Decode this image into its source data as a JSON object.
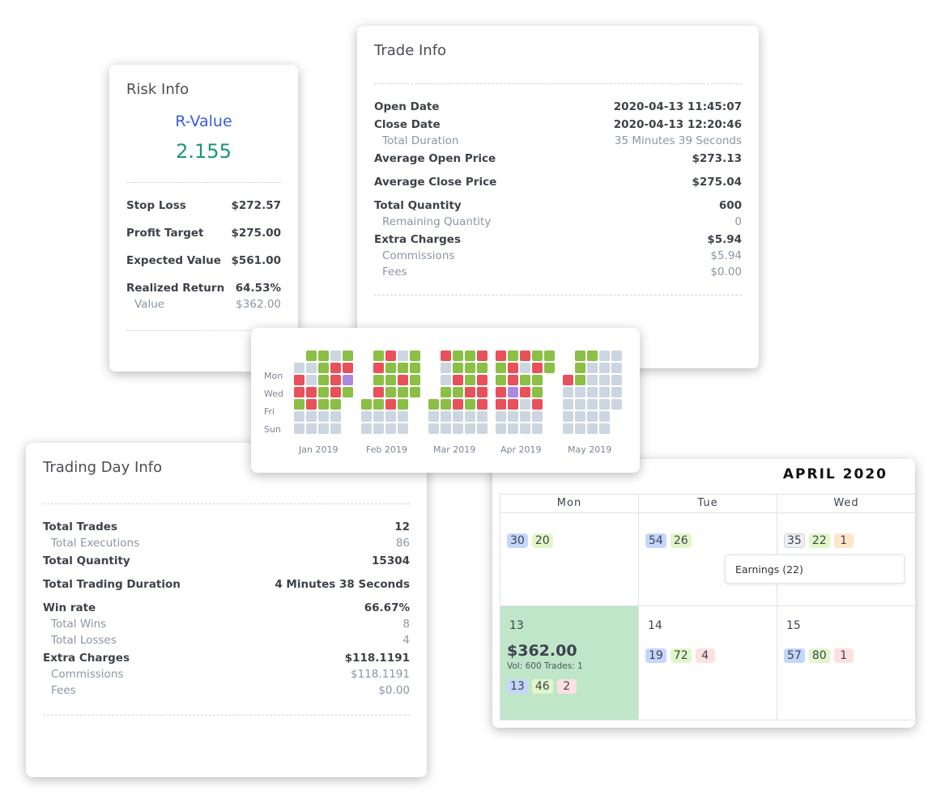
{
  "risk": {
    "title": "Risk Info",
    "rvalue_label": "R-Value",
    "rvalue": "2.155",
    "rows": [
      {
        "label": "Stop Loss",
        "value": "$272.57"
      },
      {
        "label": "Profit Target",
        "value": "$275.00"
      },
      {
        "label": "Expected Value",
        "value": "$561.00"
      },
      {
        "label": "Realized Return",
        "value": "64.53%"
      }
    ],
    "sub": {
      "label": "Value",
      "value": "$362.00"
    }
  },
  "trade": {
    "title": "Trade Info",
    "rows": [
      {
        "label": "Open Date",
        "value": "2020-04-13 11:45:07",
        "gap": true
      },
      {
        "label": "Close Date",
        "value": "2020-04-13 12:20:46"
      },
      {
        "label": "Total Duration",
        "value": "35 Minutes 39 Seconds",
        "sub": true
      },
      {
        "label": "Average Open Price",
        "value": "$273.13"
      },
      {
        "label": "Average Close Price",
        "value": "$275.04",
        "gap": true
      },
      {
        "label": "Total Quantity",
        "value": "600",
        "gap": true
      },
      {
        "label": "Remaining Quantity",
        "value": "0",
        "sub": true
      },
      {
        "label": "Extra Charges",
        "value": "$5.94"
      },
      {
        "label": "Commissions",
        "value": "$5.94",
        "sub": true
      },
      {
        "label": "Fees",
        "value": "$0.00",
        "sub": true
      }
    ]
  },
  "day": {
    "title": "Trading Day Info",
    "rows": [
      {
        "label": "Total Trades",
        "value": "12"
      },
      {
        "label": "Total Executions",
        "value": "86",
        "sub": true
      },
      {
        "label": "Total Quantity",
        "value": "15304"
      },
      {
        "label": "Total Trading Duration",
        "value": "4 Minutes 38 Seconds",
        "gap": true
      },
      {
        "label": "Win rate",
        "value": "66.67%",
        "gap": true
      },
      {
        "label": "Total Wins",
        "value": "8",
        "sub": true
      },
      {
        "label": "Total Losses",
        "value": "4",
        "sub": true
      },
      {
        "label": "Extra Charges",
        "value": "$118.1191"
      },
      {
        "label": "Commissions",
        "value": "$118.1191",
        "sub": true
      },
      {
        "label": "Fees",
        "value": "$0.00",
        "sub": true
      }
    ]
  },
  "heatmap": {
    "day_labels": [
      "Mon",
      "Wed",
      "Fri",
      "Sun"
    ],
    "colors": {
      "g": "#8bbf45",
      "r": "#e8515b",
      "x": "#ccd6e0",
      "p": "#ad8ade"
    },
    "months": [
      {
        "label": "Jan 2019",
        "rows": [
          "_ggxg",
          "xxgrr",
          "rxgrp",
          "rrgrg",
          "grgg_",
          "xxxx_",
          "xxxx_"
        ]
      },
      {
        "label": "Feb 2019",
        "rows": [
          "_grxg",
          "_rggg",
          "_ggrg",
          "_rggg",
          "ggrg_",
          "xxxx_",
          "xxxx_"
        ]
      },
      {
        "label": "Mar 2019",
        "rows": [
          "_rggr",
          "_xggg",
          "_xrgr",
          "_ggrr",
          "ggrgr",
          "xxxxx",
          "xxxxx"
        ]
      },
      {
        "label": "Apr 2019",
        "rows": [
          "rgrgg",
          "grxrg",
          "grgg_",
          "rprg_",
          "rrxr_",
          "xxxx_",
          "xxxx_"
        ]
      },
      {
        "label": "May 2019",
        "rows": [
          "_ggxx",
          "_gxxx",
          "rgxxx",
          "xxxxx",
          "xxxxx",
          "xxxx_",
          "xxxx_"
        ]
      }
    ]
  },
  "calendar": {
    "title": "APRIL 2020",
    "days": [
      "Mon",
      "Tue",
      "Wed"
    ],
    "tooltip": "Earnings (22)",
    "week1": [
      {
        "pills": [
          [
            "30",
            "b"
          ],
          [
            "20",
            "g"
          ]
        ]
      },
      {
        "pills": [
          [
            "54",
            "b"
          ],
          [
            "26",
            "g"
          ]
        ]
      },
      {
        "pills": [
          [
            "35",
            "w"
          ],
          [
            "22",
            "g"
          ],
          [
            "1",
            "o"
          ]
        ]
      }
    ],
    "week2": [
      {
        "date": "13",
        "pnl": "$362.00",
        "meta": "Vol: 600 Trades: 1",
        "pills": [
          [
            "13",
            "b"
          ],
          [
            "46",
            "g"
          ],
          [
            "2",
            "r"
          ]
        ]
      },
      {
        "date": "14",
        "pills": [
          [
            "19",
            "b"
          ],
          [
            "72",
            "g"
          ],
          [
            "4",
            "r"
          ]
        ]
      },
      {
        "date": "15",
        "pills": [
          [
            "57",
            "b"
          ],
          [
            "80",
            "g"
          ],
          [
            "1",
            "r"
          ]
        ]
      }
    ],
    "highlight": "#c0e6c9"
  }
}
